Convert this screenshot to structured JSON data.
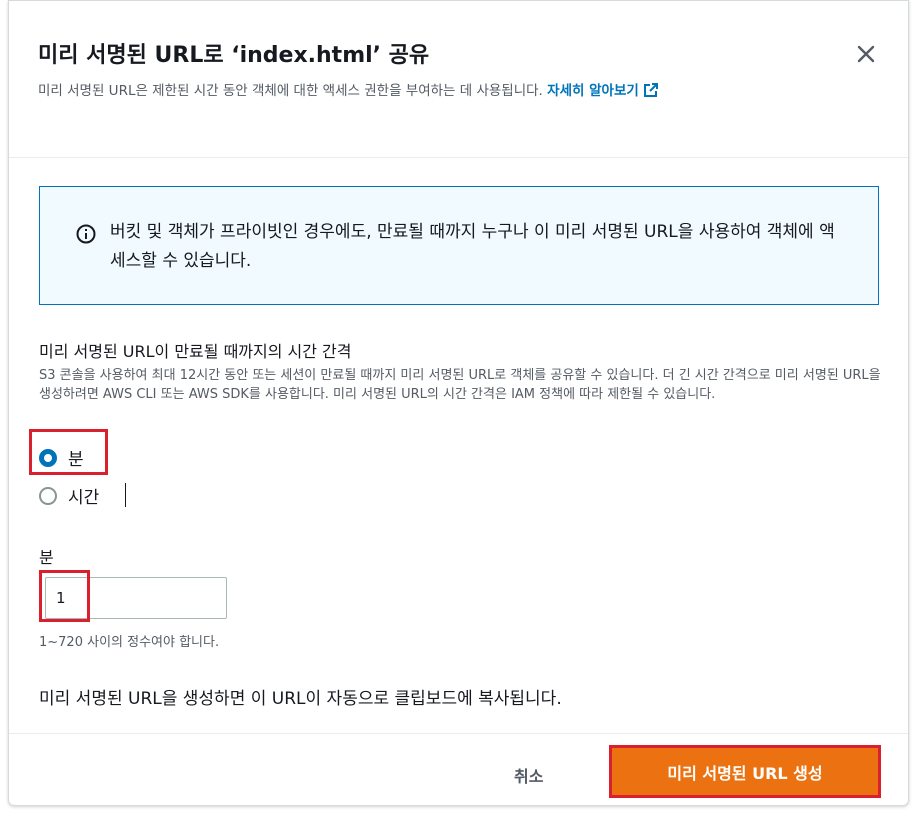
{
  "modal": {
    "title": "미리 서명된 URL로 ‘index.html’ 공유",
    "description": "미리 서명된 URL은 제한된 시간 동안 객체에 대한 액세스 권한을 부여하는 데 사용됩니다.",
    "learn_more_label": "자세히 알아보기",
    "close_icon": "close-icon"
  },
  "alert": {
    "icon": "info-icon",
    "text": "버킷 및 객체가 프라이빗인 경우에도, 만료될 때까지 누구나 이 미리 서명된 URL을 사용하여 객체에 액세스할 수 있습니다."
  },
  "interval": {
    "label": "미리 서명된 URL이 만료될 때까지의 시간 간격",
    "description": "S3 콘솔을 사용하여 최대 12시간 동안 또는 세션이 만료될 때까지 미리 서명된 URL로 객체를 공유할 수 있습니다. 더 긴 시간 간격으로 미리 서명된 URL을 생성하려면 AWS CLI 또는 AWS SDK를 사용합니다. 미리 서명된 URL의 시간 간격은 IAM 정책에 따라 제한될 수 있습니다.",
    "options": [
      {
        "label": "분",
        "checked": true
      },
      {
        "label": "시간",
        "checked": false
      }
    ]
  },
  "minutes": {
    "label": "분",
    "value": "1",
    "constraint": "1~720 사이의 정수여야 합니다."
  },
  "clipboard_note": "미리 서명된 URL을 생성하면 이 URL이 자동으로 클립보드에 복사됩니다.",
  "footer": {
    "cancel_label": "취소",
    "create_label": "미리 서명된 URL 생성"
  },
  "colors": {
    "primary": "#ec7211",
    "link": "#0073bb",
    "highlight": "#d9202c",
    "alert_bg": "#f1faff"
  }
}
